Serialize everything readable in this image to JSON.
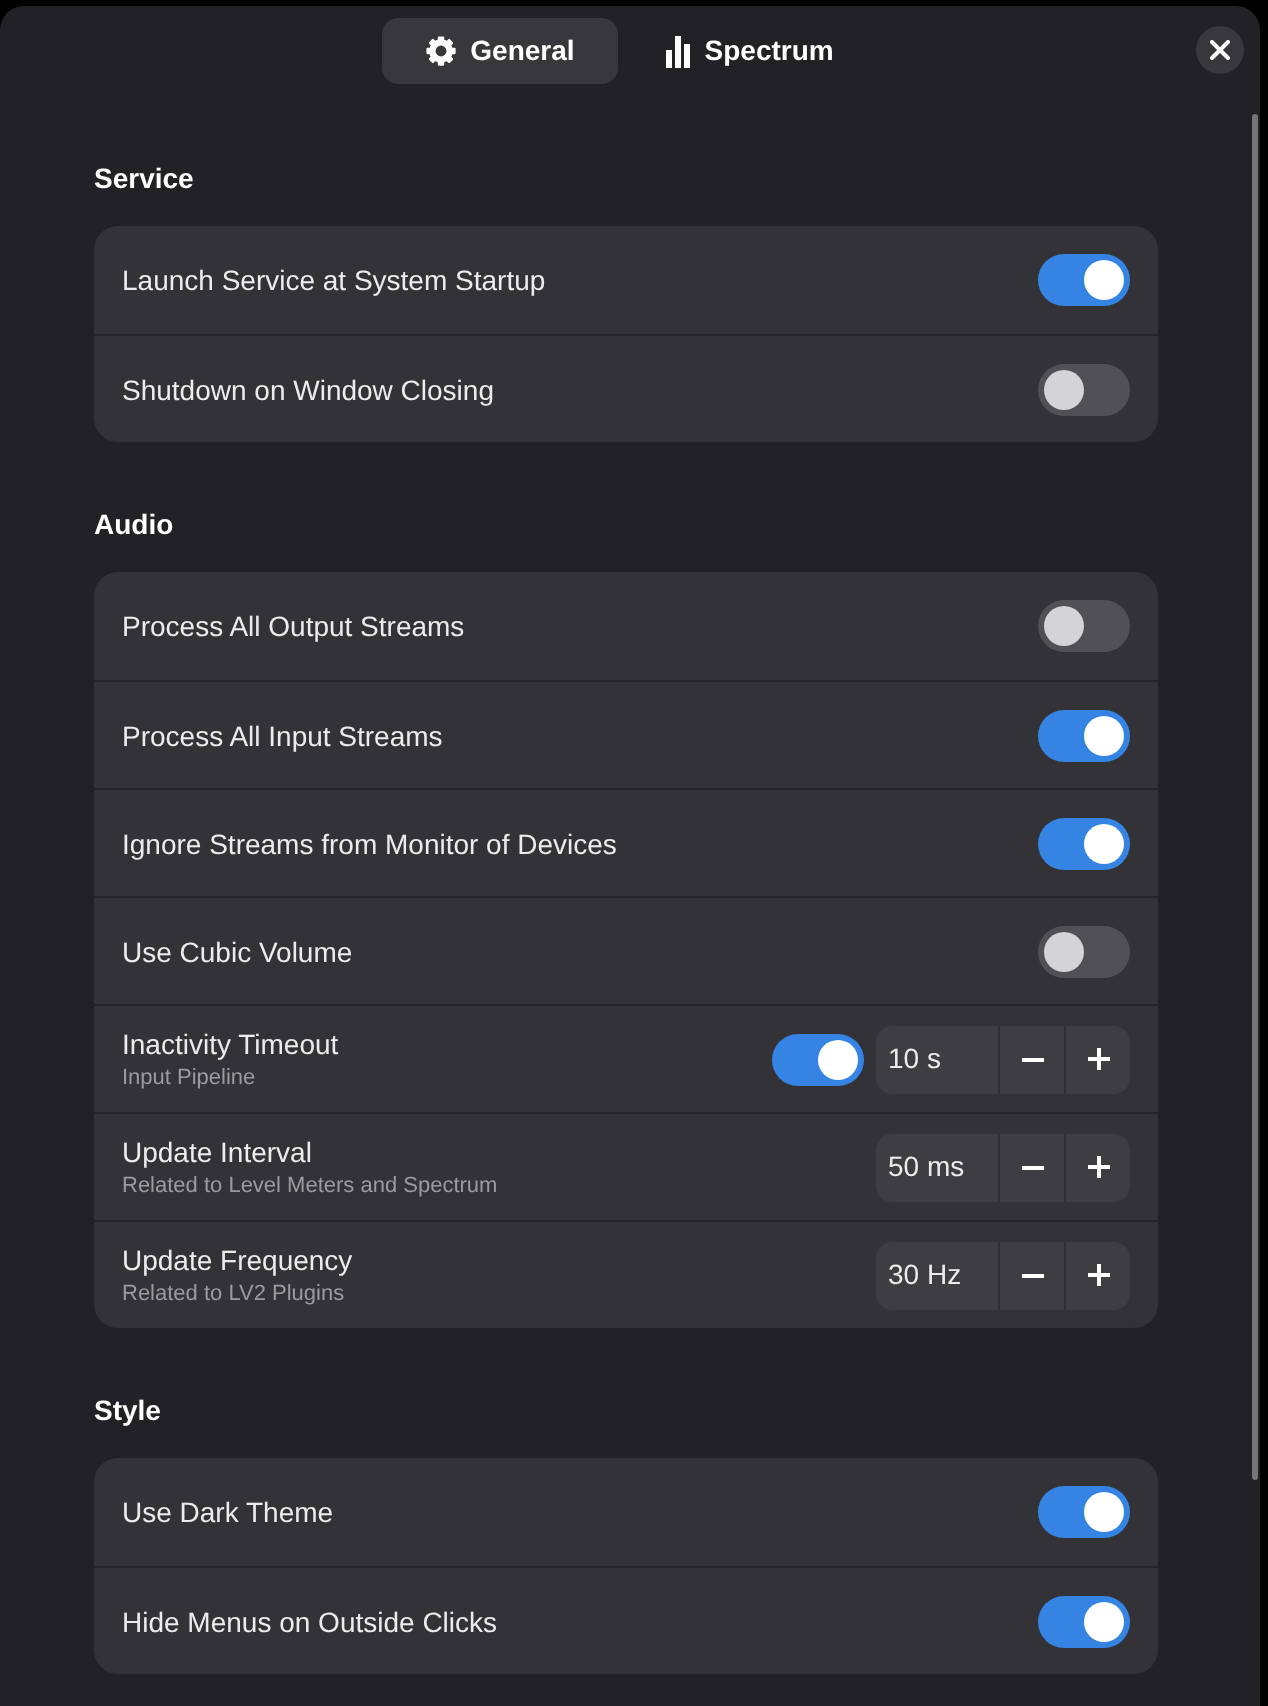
{
  "tabs": [
    {
      "label": "General",
      "selected": true
    },
    {
      "label": "Spectrum",
      "selected": false
    }
  ],
  "sections": [
    {
      "title": "Service",
      "rows": [
        {
          "kind": "switch",
          "label": "Launch Service at System Startup",
          "on": true
        },
        {
          "kind": "switch",
          "label": "Shutdown on Window Closing",
          "on": false
        }
      ]
    },
    {
      "title": "Audio",
      "rows": [
        {
          "kind": "switch",
          "label": "Process All Output Streams",
          "on": false
        },
        {
          "kind": "switch",
          "label": "Process All Input Streams",
          "on": true
        },
        {
          "kind": "switch",
          "label": "Ignore Streams from Monitor of Devices",
          "on": true
        },
        {
          "kind": "switch",
          "label": "Use Cubic Volume",
          "on": false
        },
        {
          "kind": "switch_spin",
          "label": "Inactivity Timeout",
          "subtitle": "Input Pipeline",
          "on": true,
          "value": "10 s"
        },
        {
          "kind": "spin",
          "label": "Update Interval",
          "subtitle": "Related to Level Meters and Spectrum",
          "value": "50 ms"
        },
        {
          "kind": "spin",
          "label": "Update Frequency",
          "subtitle": "Related to LV2 Plugins",
          "value": "30 Hz"
        }
      ]
    },
    {
      "title": "Style",
      "rows": [
        {
          "kind": "switch",
          "label": "Use Dark Theme",
          "on": true
        },
        {
          "kind": "switch",
          "label": "Hide Menus on Outside Clicks",
          "on": true
        }
      ]
    }
  ]
}
